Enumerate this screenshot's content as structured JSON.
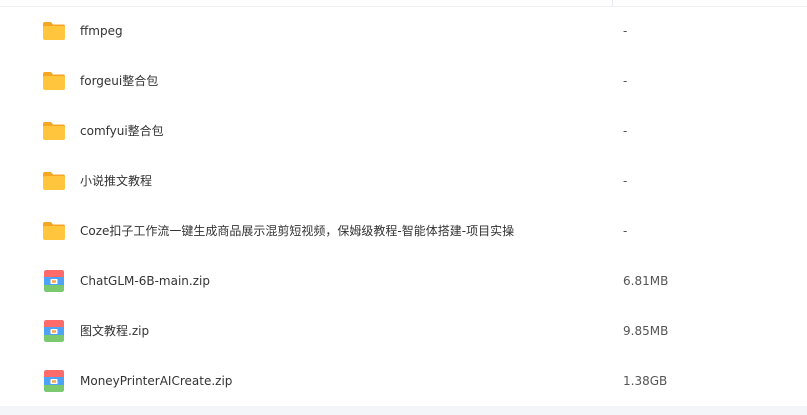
{
  "files": [
    {
      "name": "ffmpeg",
      "size": "-",
      "icon": "folder-icon"
    },
    {
      "name": "forgeui整合包",
      "size": "-",
      "icon": "folder-icon"
    },
    {
      "name": "comfyui整合包",
      "size": "-",
      "icon": "folder-icon"
    },
    {
      "name": "小说推文教程",
      "size": "-",
      "icon": "folder-icon"
    },
    {
      "name": "Coze扣子工作流一键生成商品展示混剪短视频，保姆级教程-智能体搭建-项目实操",
      "size": "-",
      "icon": "folder-icon"
    },
    {
      "name": "ChatGLM-6B-main.zip",
      "size": "6.81MB",
      "icon": "zip-archive-icon"
    },
    {
      "name": "图文教程.zip",
      "size": "9.85MB",
      "icon": "zip-archive-icon"
    },
    {
      "name": "MoneyPrinterAICreate.zip",
      "size": "1.38GB",
      "icon": "zip-archive-icon"
    }
  ],
  "colors": {
    "folder": "#FFC53D",
    "folder_back": "#F5A623",
    "zip_top": "#FF6B6B",
    "zip_mid": "#4FA3F7",
    "zip_bottom": "#7BC96F"
  }
}
